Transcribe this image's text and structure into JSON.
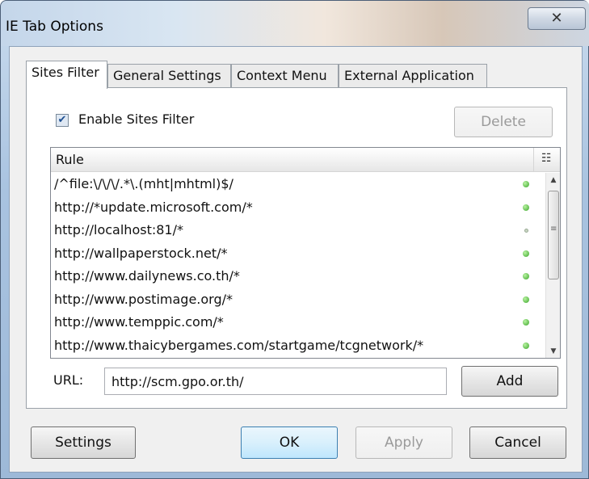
{
  "window": {
    "title": "IE Tab Options",
    "close_glyph": "✕"
  },
  "tabs": [
    {
      "label": "Sites Filter",
      "active": true
    },
    {
      "label": "General Settings",
      "active": false
    },
    {
      "label": "Context Menu",
      "active": false
    },
    {
      "label": "External Application",
      "active": false
    }
  ],
  "sites_filter": {
    "enable_label": "Enable Sites Filter",
    "enable_checked": true,
    "delete_label": "Delete",
    "list": {
      "column_header": "Rule",
      "column_picker_icon": "column-picker-icon",
      "rows": [
        {
          "rule": "/^file:\\/\\/\\/.*\\.(mht|mhtml)$/",
          "enabled": true
        },
        {
          "rule": "http://*update.microsoft.com/*",
          "enabled": true
        },
        {
          "rule": "http://localhost:81/*",
          "enabled": false
        },
        {
          "rule": "http://wallpaperstock.net/*",
          "enabled": true
        },
        {
          "rule": "http://www.dailynews.co.th/*",
          "enabled": true
        },
        {
          "rule": "http://www.postimage.org/*",
          "enabled": true
        },
        {
          "rule": "http://www.temppic.com/*",
          "enabled": true
        },
        {
          "rule": "http://www.thaicybergames.com/startgame/tcgnetwork/*",
          "enabled": true
        }
      ]
    },
    "url_label": "URL:",
    "url_value": "http://scm.gpo.or.th/",
    "add_label": "Add"
  },
  "footer": {
    "settings_label": "Settings",
    "ok_label": "OK",
    "apply_label": "Apply",
    "cancel_label": "Cancel"
  },
  "colors": {
    "enabled_dot": "#3aa52a",
    "default_button_border": "#3c7fb1"
  }
}
